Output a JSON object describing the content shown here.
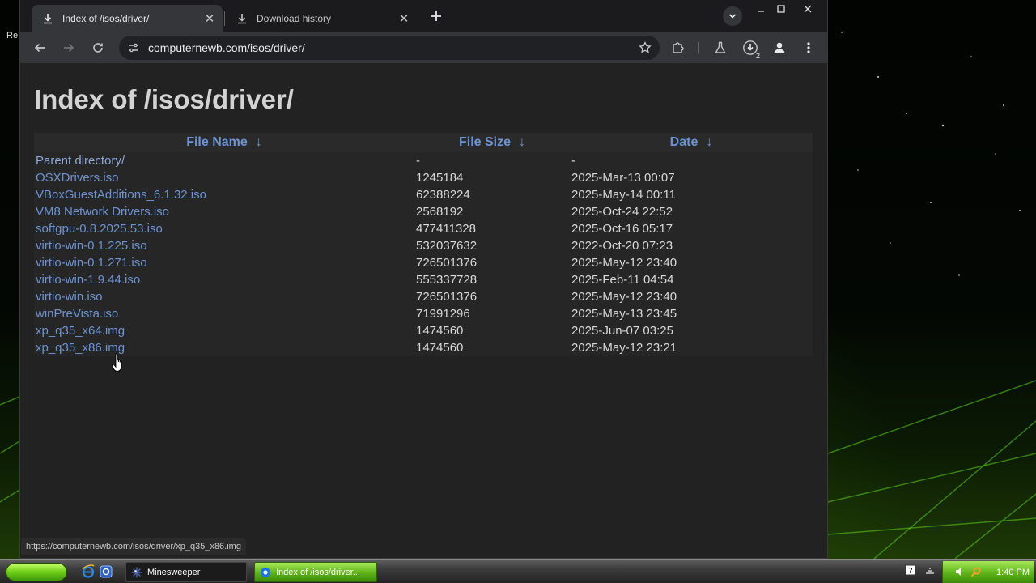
{
  "desktop": {
    "label": "Re"
  },
  "browser": {
    "tabs": [
      {
        "title": "Index of /isos/driver/",
        "active": true
      },
      {
        "title": "Download history",
        "active": false
      }
    ],
    "address": "computernewb.com/isos/driver/",
    "download_badge": "2",
    "status_url": "https://computernewb.com/isos/driver/xp_q35_x86.img"
  },
  "page": {
    "title": "Index of /isos/driver/",
    "columns": {
      "name": "File Name",
      "size": "File Size",
      "date": "Date",
      "sort_arrow": "↓"
    },
    "rows": [
      {
        "name": "Parent directory/",
        "size": "-",
        "date": "-"
      },
      {
        "name": "OSXDrivers.iso",
        "size": "1245184",
        "date": "2025-Mar-13 00:07"
      },
      {
        "name": "VBoxGuestAdditions_6.1.32.iso",
        "size": "62388224",
        "date": "2025-May-14 00:11"
      },
      {
        "name": "VM8 Network Drivers.iso",
        "size": "2568192",
        "date": "2025-Oct-24 22:52"
      },
      {
        "name": "softgpu-0.8.2025.53.iso",
        "size": "477411328",
        "date": "2025-Oct-16 05:17"
      },
      {
        "name": "virtio-win-0.1.225.iso",
        "size": "532037632",
        "date": "2022-Oct-20 07:23"
      },
      {
        "name": "virtio-win-0.1.271.iso",
        "size": "726501376",
        "date": "2025-May-12 23:40"
      },
      {
        "name": "virtio-win-1.9.44.iso",
        "size": "555337728",
        "date": "2025-Feb-11 04:54"
      },
      {
        "name": "virtio-win.iso",
        "size": "726501376",
        "date": "2025-May-12 23:40"
      },
      {
        "name": "winPreVista.iso",
        "size": "71991296",
        "date": "2025-May-13 23:45"
      },
      {
        "name": "xp_q35_x64.img",
        "size": "1474560",
        "date": "2025-Jun-07 03:25"
      },
      {
        "name": "xp_q35_x86.img",
        "size": "1474560",
        "date": "2025-May-12 23:21"
      }
    ]
  },
  "taskbar": {
    "tasks": [
      {
        "label": "Minesweeper"
      },
      {
        "label": "Index of /isos/driver..."
      }
    ],
    "clock": "1:40 PM"
  },
  "colors": {
    "link": "#6c93d3",
    "page_bg": "#222222",
    "taskbar_green": "#5eb419"
  },
  "icons": {
    "back": "arrow-left-icon",
    "forward": "arrow-right-icon",
    "reload": "reload-icon",
    "site_info": "tune-icon",
    "bookmark": "star-icon",
    "extensions": "puzzle-icon",
    "labs": "flask-icon",
    "downloads": "download-icon",
    "profile": "person-icon",
    "menu": "kebab-menu-icon"
  }
}
